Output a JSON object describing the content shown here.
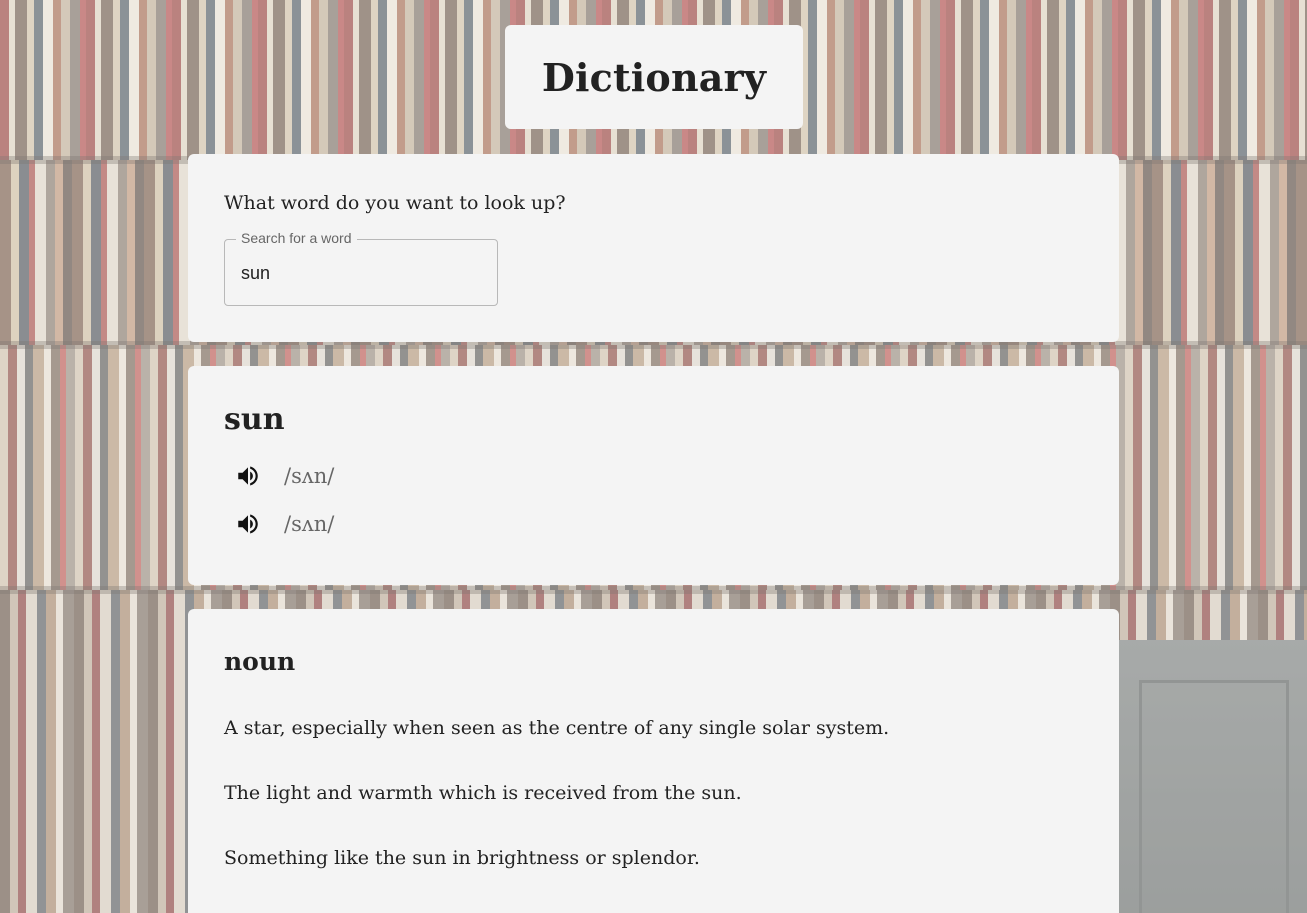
{
  "app": {
    "title": "Dictionary"
  },
  "search": {
    "prompt": "What word do you want to look up?",
    "legend": "Search for a word",
    "value": "sun"
  },
  "entry": {
    "word": "sun",
    "phonetics": [
      {
        "text": "/sʌn/",
        "icon": "volume-up-icon"
      },
      {
        "text": "/sʌn/",
        "icon": "volume-up-icon"
      }
    ]
  },
  "meaning": {
    "part_of_speech": "noun",
    "definitions": [
      "A star, especially when seen as the centre of any single solar system.",
      "The light and warmth which is received from the sun.",
      "Something like the sun in brightness or splendor."
    ]
  },
  "colors": {
    "card_background": "#f4f4f4",
    "text": "#222222",
    "muted_text": "#666666",
    "field_border": "#b8b8b8"
  }
}
